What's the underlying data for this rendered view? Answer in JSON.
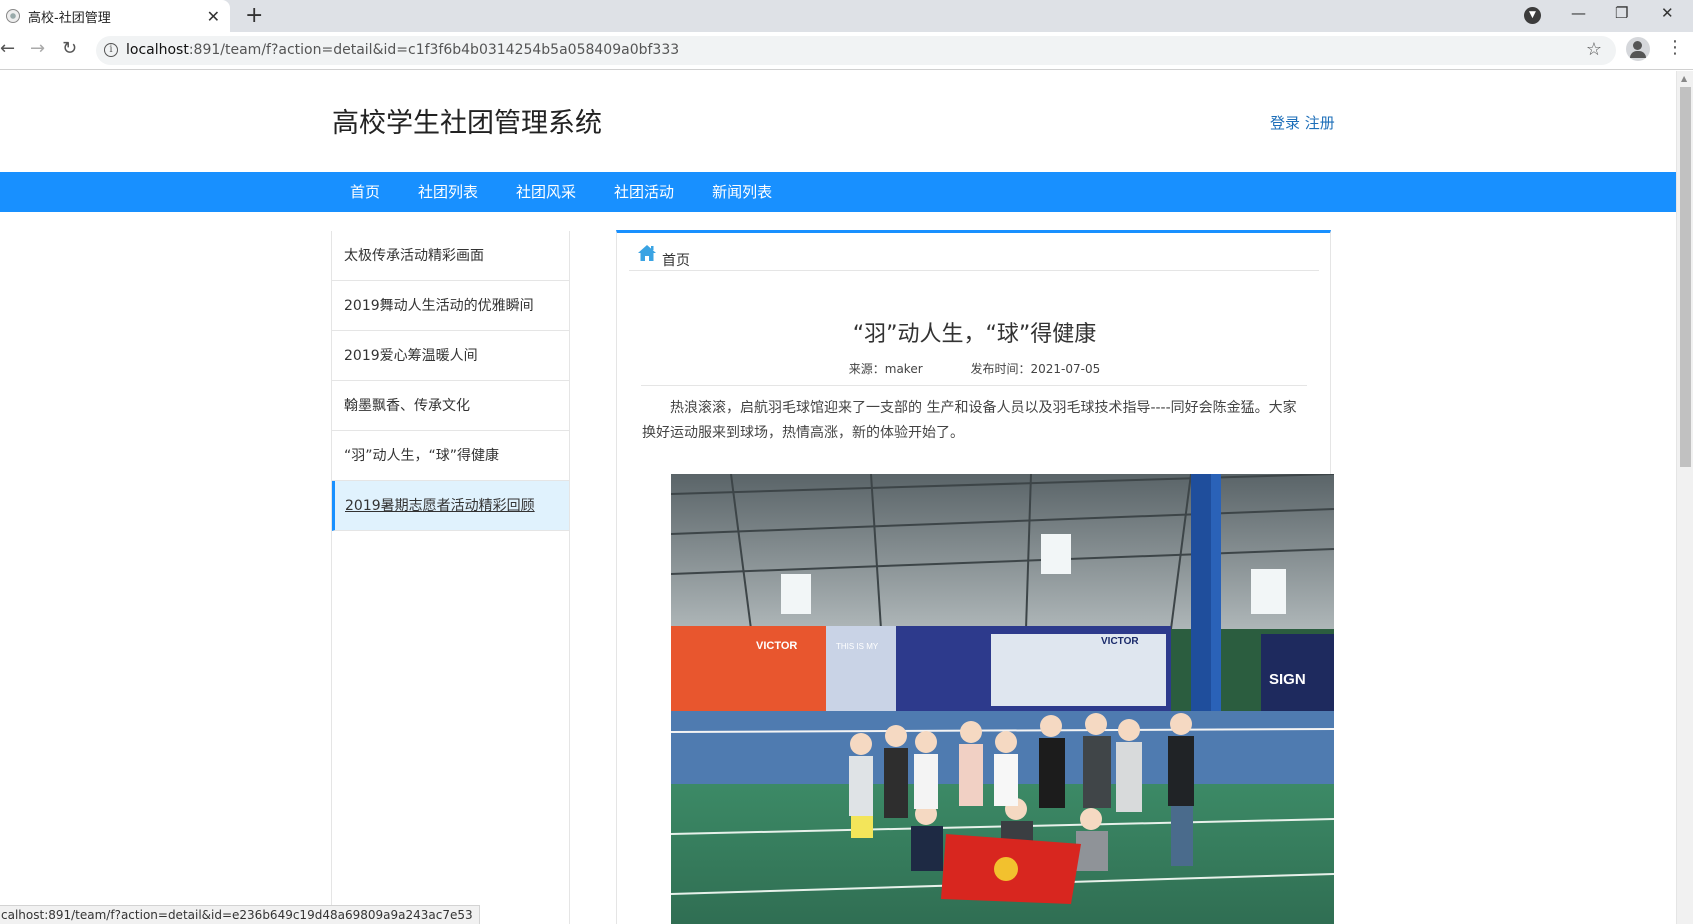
{
  "browser": {
    "tab_title": "高校-社团管理",
    "url_host": "localhost",
    "url_rest": ":891/team/f?action=detail&id=c1f3f6b4b0314254b5a058409a0bf333",
    "status_url": "calhost:891/team/f?action=detail&id=e236b649c19d48a69809a9a243ac7e53"
  },
  "site": {
    "title": "高校学生社团管理系统",
    "login": "登录",
    "register": "注册"
  },
  "nav": [
    "首页",
    "社团列表",
    "社团风采",
    "社团活动",
    "新闻列表"
  ],
  "sidebar": {
    "items": [
      {
        "label": "太极传承活动精彩画面"
      },
      {
        "label": "2019舞动人生活动的优雅瞬间"
      },
      {
        "label": "2019爱心筹温暖人间"
      },
      {
        "label": "翰墨飘香、传承文化"
      },
      {
        "label": "“羽”动人生，“球”得健康"
      },
      {
        "label": "2019暑期志愿者活动精彩回顾"
      }
    ],
    "active_index": 5
  },
  "breadcrumb": {
    "home": "首页"
  },
  "article": {
    "title": "“羽”动人生，“球”得健康",
    "source": "来源：maker",
    "publish_time": "发布时间：2021-07-05",
    "body": "热浪滚滚，启航羽毛球馆迎来了一支部的 生产和设备人员以及羽毛球技术指导----同好会陈金猛。大家换好运动服来到球场，热情高涨，新的体验开始了。"
  },
  "photo_banners": {
    "brand": "VICTOR",
    "slogan": "THIS IS MY",
    "signature": "SIGN"
  },
  "colors": {
    "accent": "#1890ff",
    "link": "#1e6fb9",
    "active_bg": "#e0f2fd"
  }
}
